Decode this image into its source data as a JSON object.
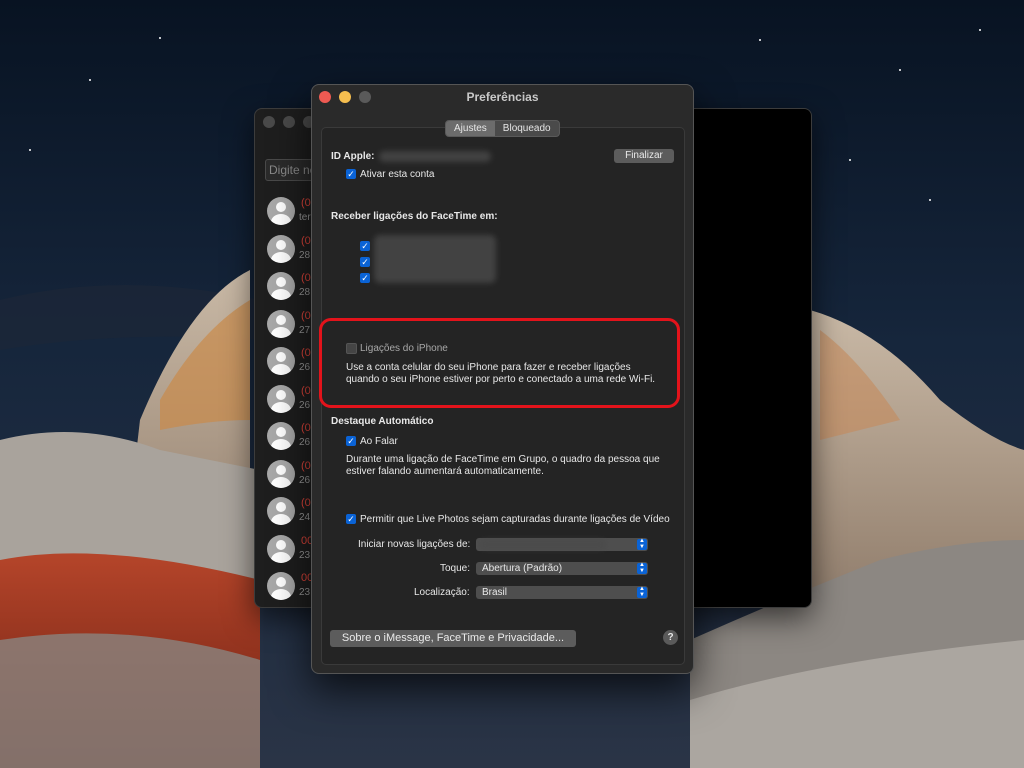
{
  "colors": {
    "accent": "#0a63d6",
    "highlight": "#e3131b",
    "missed_call": "#e0443a"
  },
  "background_window": {
    "search_placeholder": "Digite no",
    "contacts": [
      {
        "num": "(0",
        "date": "ter"
      },
      {
        "num": "(0",
        "date": "28"
      },
      {
        "num": "(0",
        "date": "28"
      },
      {
        "num": "(0",
        "date": "27"
      },
      {
        "num": "(0",
        "date": "26"
      },
      {
        "num": "(0",
        "date": "26"
      },
      {
        "num": "(0",
        "date": "26"
      },
      {
        "num": "(0",
        "date": "26"
      },
      {
        "num": "(0",
        "date": "24"
      },
      {
        "num": "00",
        "date": "23"
      },
      {
        "num": "00",
        "date": "23"
      }
    ]
  },
  "prefs": {
    "title": "Preferências",
    "tabs": [
      {
        "label": "Ajustes",
        "active": true
      },
      {
        "label": "Bloqueado",
        "active": false
      }
    ],
    "apple_id_label": "ID Apple:",
    "sign_out_label": "Finalizar",
    "enable_account_label": "Ativar esta conta",
    "receive_calls_label": "Receber ligações do FaceTime em:",
    "iphone_calls_label": "Ligações do iPhone",
    "iphone_calls_desc_1": "Use a conta celular do seu iPhone para fazer e receber ligações",
    "iphone_calls_desc_2": "quando o seu iPhone estiver por perto e conectado a uma rede Wi-Fi.",
    "auto_prominence_label": "Destaque Automático",
    "speaking_label": "Ao Falar",
    "speaking_desc_1": "Durante uma ligação de FaceTime em Grupo, o quadro da pessoa que",
    "speaking_desc_2": "estiver falando aumentará automaticamente.",
    "live_photos_label": "Permitir que Live Photos sejam capturadas durante ligações de Vídeo",
    "start_calls_label": "Iniciar novas ligações de:",
    "ringtone_label": "Toque:",
    "ringtone_value": "Abertura (Padrão)",
    "location_label": "Localização:",
    "location_value": "Brasil",
    "privacy_button_label": "Sobre o iMessage, FaceTime e Privacidade...",
    "help_label": "?"
  }
}
